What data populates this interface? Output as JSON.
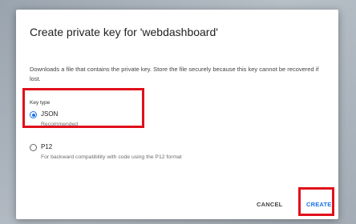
{
  "dialog": {
    "title": "Create private key for 'webdashboard'",
    "description": "Downloads a file that contains the private key. Store the file securely because this key cannot be recovered if lost."
  },
  "key_type": {
    "label": "Key type",
    "options": [
      {
        "label": "JSON",
        "sublabel": "Recommended",
        "selected": true
      },
      {
        "label": "P12",
        "sublabel": "For backward compatibility with code using the P12 format",
        "selected": false
      }
    ]
  },
  "actions": {
    "cancel_label": "CANCEL",
    "create_label": "CREATE"
  },
  "colors": {
    "accent": "#1a73e8",
    "highlight": "#e0101a"
  }
}
